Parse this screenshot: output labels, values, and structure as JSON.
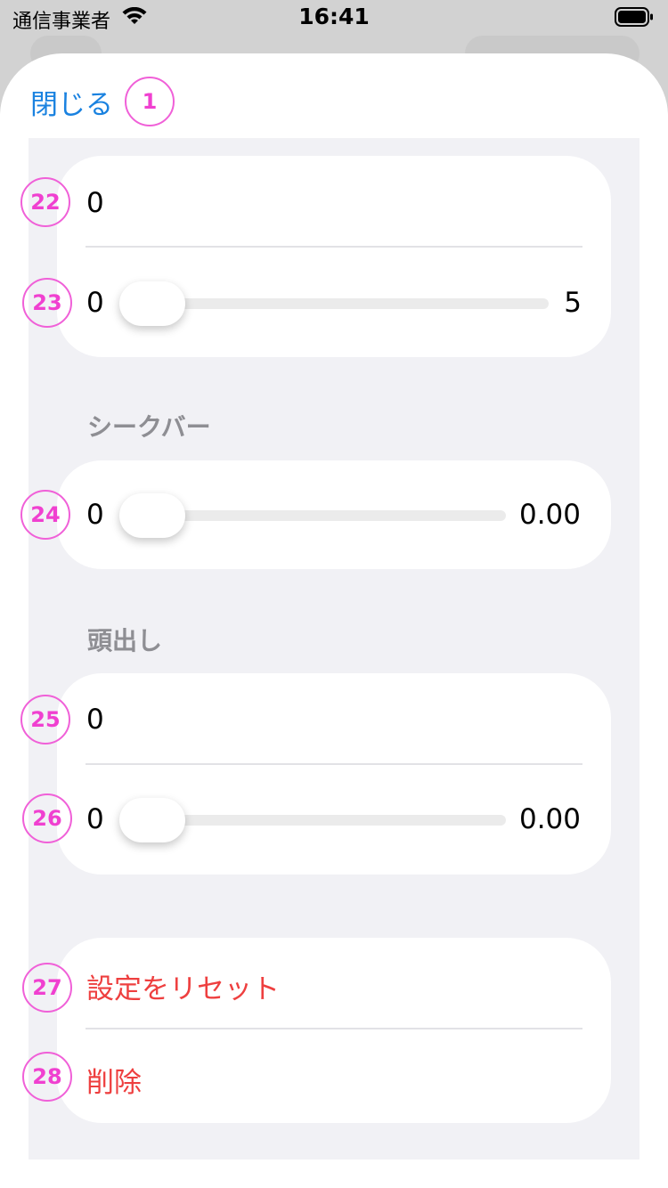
{
  "status_bar": {
    "carrier": "通信事業者",
    "time": "16:41"
  },
  "header": {
    "close_label": "閉じる"
  },
  "sections": {
    "top": {
      "value_field": "0",
      "slider": {
        "min_label": "0",
        "max_label": "5",
        "level": 0
      }
    },
    "seekbar": {
      "header": "シークバー",
      "slider": {
        "min_label": "0",
        "max_label": "0.00",
        "level": 0
      }
    },
    "cue": {
      "header": "頭出し",
      "value_field": "0",
      "slider": {
        "min_label": "0",
        "max_label": "0.00",
        "level": 0
      }
    },
    "actions": {
      "reset_label": "設定をリセット",
      "delete_label": "削除"
    }
  },
  "badges": [
    "1",
    "22",
    "23",
    "24",
    "25",
    "26",
    "27",
    "28"
  ],
  "colors": {
    "link_blue": "#1a82e0",
    "destructive_red": "#ee3f3f",
    "badge_magenta": "#f040d0",
    "grouped_bg": "#f1f1f5"
  }
}
